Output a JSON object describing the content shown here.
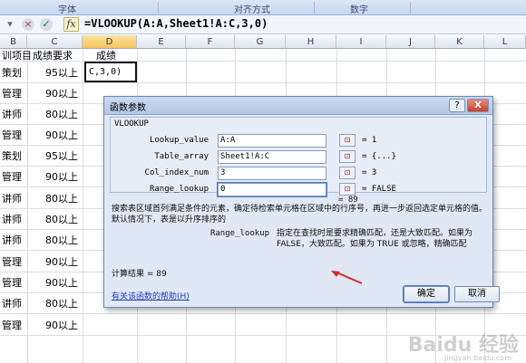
{
  "ribbon": {
    "groups": [
      "字体",
      "对齐方式",
      "数字"
    ]
  },
  "formula_bar": {
    "cancel_glyph": "×",
    "enter_glyph": "✓",
    "fx_label": "fx",
    "formula": "=VLOOKUP(A:A,Sheet1!A:C,3,0)"
  },
  "columns": [
    "B",
    "C",
    "D",
    "E",
    "F",
    "G",
    "H",
    "I",
    "J",
    "K",
    "L"
  ],
  "active_column": "D",
  "rows": [
    {
      "b": "训项目",
      "c": "成绩要求",
      "d": "成绩"
    },
    {
      "b": "策划",
      "c": "95以上",
      "d": "C,3,0)"
    },
    {
      "b": "管理",
      "c": "90以上",
      "d": ""
    },
    {
      "b": "讲师",
      "c": "80以上",
      "d": ""
    },
    {
      "b": "管理",
      "c": "90以上",
      "d": ""
    },
    {
      "b": "策划",
      "c": "95以上",
      "d": ""
    },
    {
      "b": "管理",
      "c": "90以上",
      "d": ""
    },
    {
      "b": "讲师",
      "c": "80以上",
      "d": ""
    },
    {
      "b": "讲师",
      "c": "80以上",
      "d": ""
    },
    {
      "b": "讲师",
      "c": "80以上",
      "d": ""
    },
    {
      "b": "管理",
      "c": "90以上",
      "d": ""
    },
    {
      "b": "管理",
      "c": "90以上",
      "d": ""
    },
    {
      "b": "讲师",
      "c": "80以上",
      "d": ""
    },
    {
      "b": "管理",
      "c": "90以上",
      "d": ""
    }
  ],
  "dialog": {
    "title": "函数参数",
    "help_label": "?",
    "close_label": "X",
    "function_name": "VLOOKUP",
    "fields": [
      {
        "label": "Lookup_value",
        "value": "A:A",
        "result": "= 1"
      },
      {
        "label": "Table_array",
        "value": "Sheet1!A:C",
        "result": "= {...}"
      },
      {
        "label": "Col_index_num",
        "value": "3",
        "result": "= 3"
      },
      {
        "label": "Range_lookup",
        "value": "0",
        "result": "= FALSE"
      }
    ],
    "overall_result": "= 89",
    "description": "搜索表区域首列满足条件的元素，确定待检索单元格在区域中的行序号，再进一步返回选定单元格的值。默认情况下，表是以升序排序的",
    "param_name": "Range_lookup",
    "param_description": "指定在查找时是要求精确匹配，还是大致匹配。如果为 FALSE，大致匹配。如果为 TRUE 或忽略，精确匹配",
    "calc_result_label": "计算结果 = 89",
    "help_link": "有关该函数的帮助(H)",
    "ok_label": "确定",
    "cancel_label": "取消",
    "field_icon": "⊡",
    "colors": {
      "accent": "#1f3fbf",
      "arrow": "#d9262c"
    }
  },
  "watermark": {
    "main": "Baidu 经验",
    "sub": "jingyan.baidu.com"
  }
}
